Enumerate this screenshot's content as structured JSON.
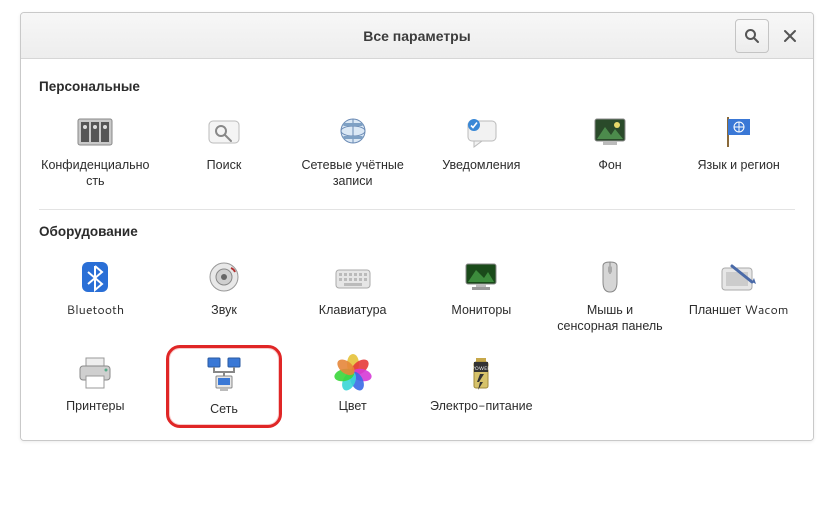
{
  "header": {
    "title": "Все параметры"
  },
  "sections": {
    "personal": "Персональные",
    "hardware": "Оборудование"
  },
  "personal": {
    "privacy": "Конфиденциальность",
    "search": "Поиск",
    "online_accounts": "Сетевые учётные записи",
    "notifications": "Уведомления",
    "background": "Фон",
    "region": "Язык и регион"
  },
  "hardware": {
    "bluetooth": "Bluetooth",
    "sound": "Звук",
    "keyboard": "Клавиатура",
    "displays": "Мониторы",
    "mouse": "Мышь и сенсорная панель",
    "wacom": "Планшет Wacom",
    "printers": "Принтеры",
    "network": "Сеть",
    "color": "Цвет",
    "power": "Электро-питание"
  }
}
